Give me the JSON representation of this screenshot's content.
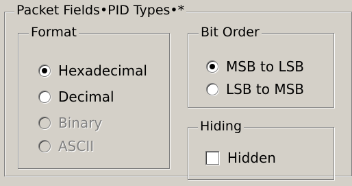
{
  "packet_fields": {
    "title": "Packet Fields•PID Types•*"
  },
  "format": {
    "title": "Format",
    "options": [
      {
        "label": "Hexadecimal",
        "checked": true,
        "enabled": true
      },
      {
        "label": "Decimal",
        "checked": false,
        "enabled": true
      },
      {
        "label": "Binary",
        "checked": false,
        "enabled": false
      },
      {
        "label": "ASCII",
        "checked": false,
        "enabled": false
      }
    ]
  },
  "bit_order": {
    "title": "Bit Order",
    "options": [
      {
        "label": "MSB to LSB",
        "checked": true,
        "enabled": true
      },
      {
        "label": "LSB to MSB",
        "checked": false,
        "enabled": true
      }
    ]
  },
  "hiding": {
    "title": "Hiding",
    "hidden_label": "Hidden",
    "hidden_checked": false
  },
  "colors": {
    "dialog_background": "#d4d0c8",
    "disabled_text": "#808080"
  },
  "icons": [
    "radio-checked-icon",
    "radio-unchecked-icon",
    "checkbox-icon"
  ]
}
